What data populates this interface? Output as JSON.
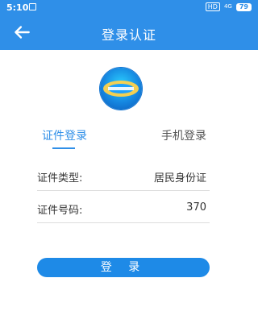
{
  "status_bar": {
    "time": "5:10",
    "network_badge": "HD",
    "network_type": "4G",
    "battery": "79"
  },
  "app_bar": {
    "title": "登录认证",
    "back_icon": "arrow-left-icon"
  },
  "tabs": [
    {
      "label": "证件登录",
      "active": true
    },
    {
      "label": "手机登录",
      "active": false
    }
  ],
  "form": {
    "id_type_label": "证件类型:",
    "id_type_value": "居民身份证",
    "id_number_label": "证件号码:",
    "id_number_value": "370"
  },
  "login_button": "登 录",
  "colors": {
    "primary": "#2f8fe8",
    "button": "#1e8ae7",
    "divider": "#dcdcdc"
  }
}
